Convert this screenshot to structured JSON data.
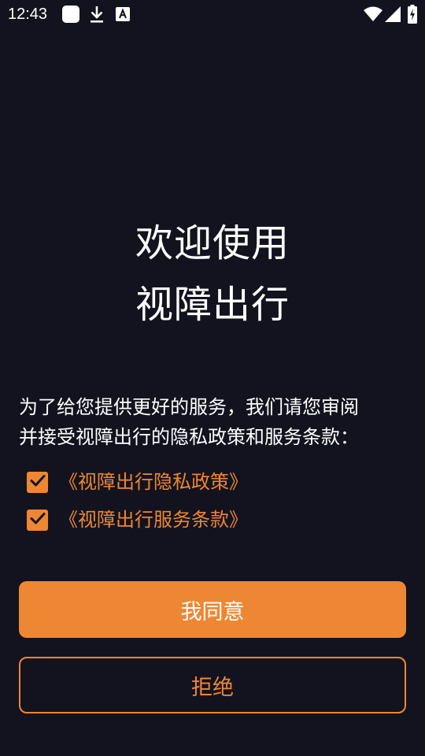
{
  "status_bar": {
    "time": "12:43",
    "icons": [
      "notification-square-icon",
      "download-icon",
      "font-a-icon",
      "wifi-icon",
      "signal-icon",
      "battery-charging-icon"
    ]
  },
  "welcome": {
    "line1": "欢迎使用",
    "line2": "视障出行"
  },
  "prompt": {
    "line1": "为了给您提供更好的服务，我们请您审阅",
    "line2": "并接受视障出行的隐私政策和服务条款："
  },
  "agreements": [
    {
      "label": "《视障出行隐私政策》",
      "checked": true
    },
    {
      "label": "《视障出行服务条款》",
      "checked": true
    }
  ],
  "buttons": {
    "agree": "我同意",
    "reject": "拒绝"
  },
  "colors": {
    "background": "#13131f",
    "accent": "#ee8733",
    "text": "#ffffff"
  }
}
